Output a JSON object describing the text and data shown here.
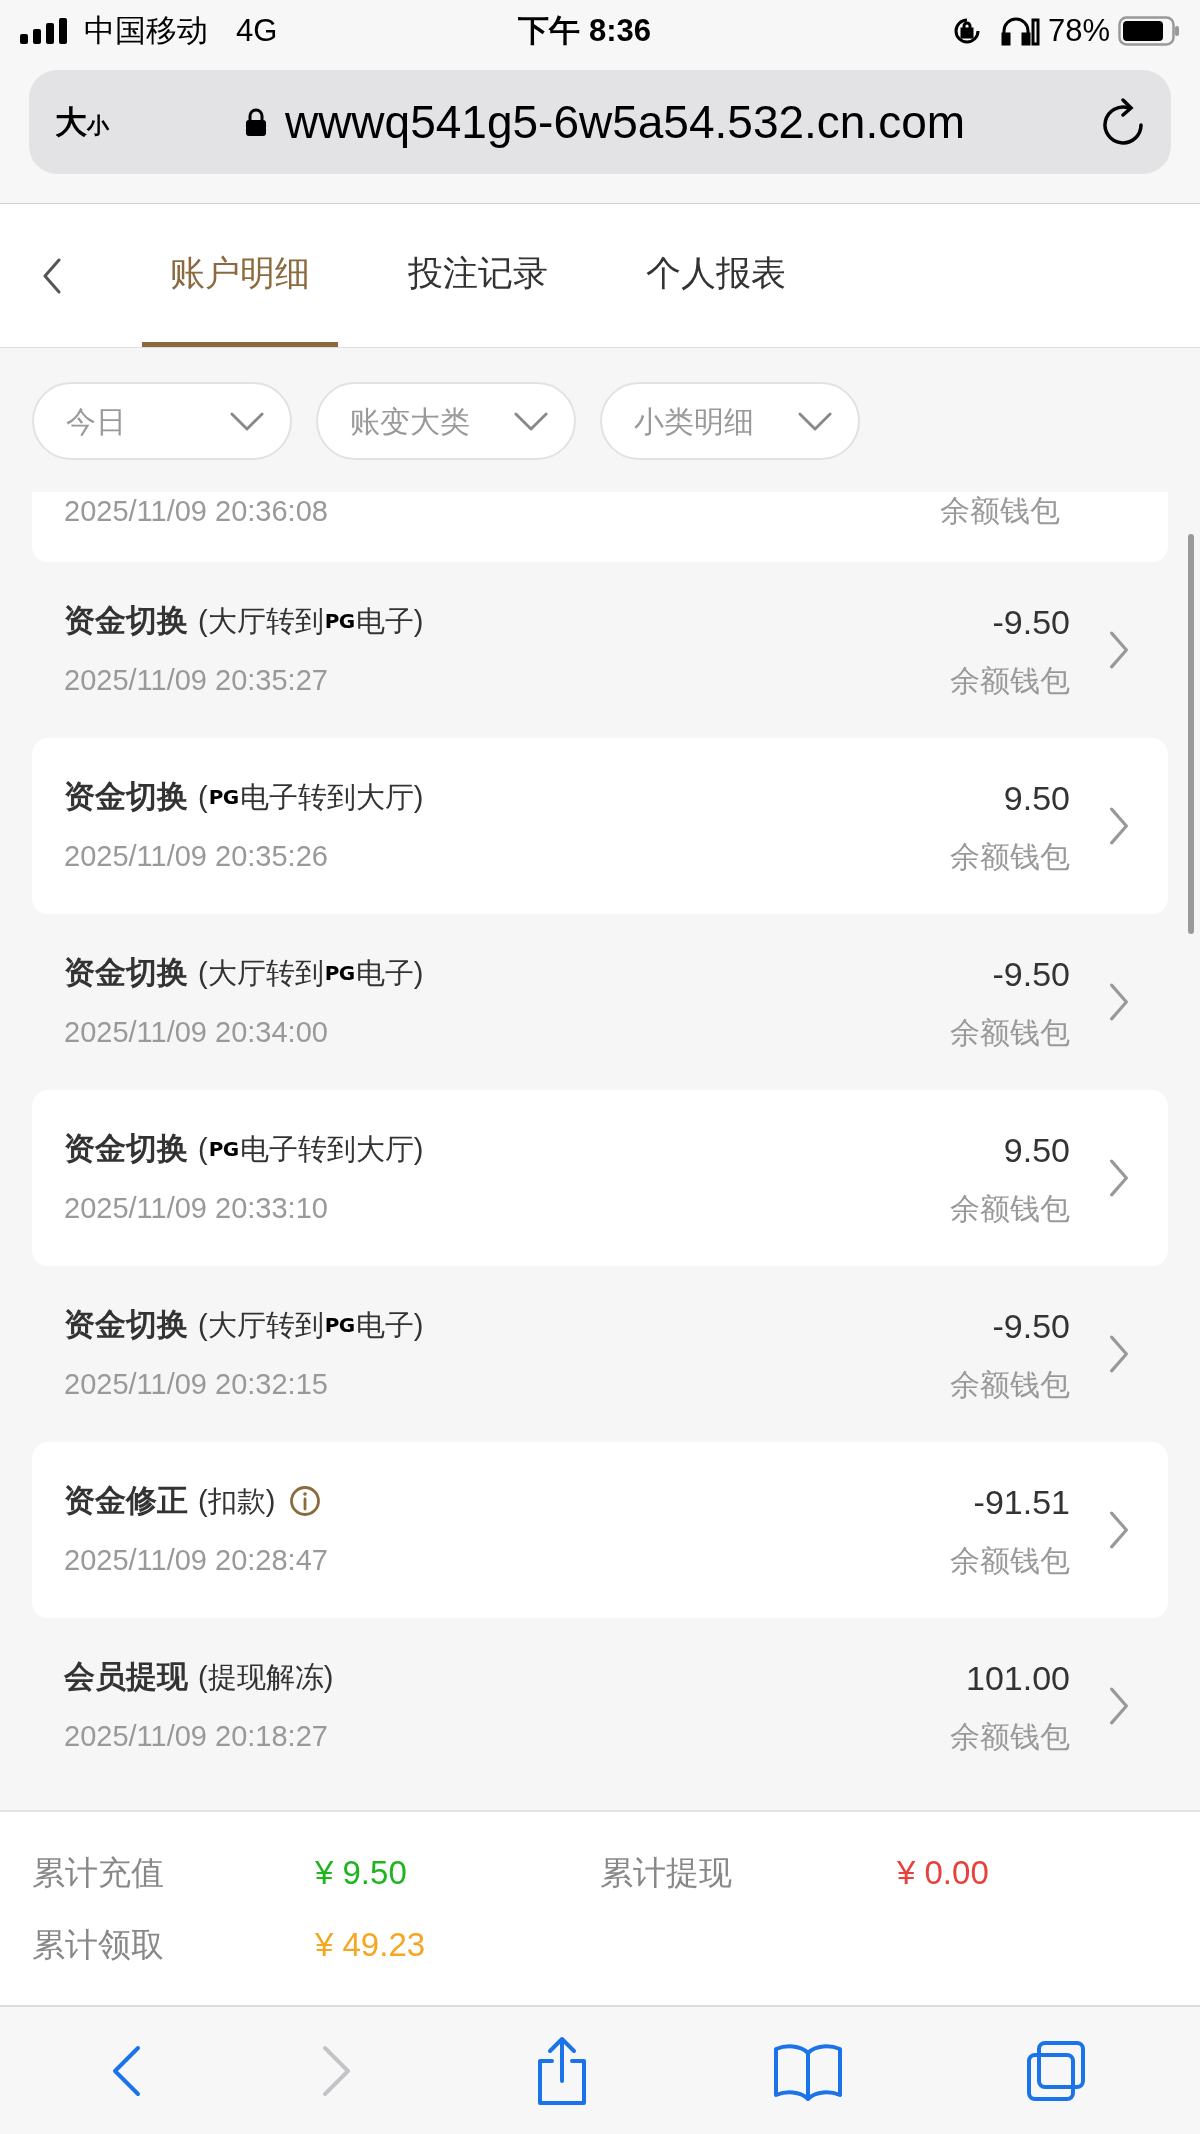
{
  "status_bar": {
    "carrier": "中国移动",
    "network": "4G",
    "time": "下午 8:36",
    "battery": "78%"
  },
  "address_bar": {
    "text_size": [
      "大",
      "小"
    ],
    "url": "wwwq541g5-6w5a54.532.cn.com"
  },
  "tabs": [
    {
      "label": "账户明细",
      "selected": true
    },
    {
      "label": "投注记录",
      "selected": false
    },
    {
      "label": "个人报表",
      "selected": false
    }
  ],
  "filters": [
    {
      "label": "今日"
    },
    {
      "label": "账变大类"
    },
    {
      "label": "小类明细"
    }
  ],
  "partial_row": {
    "time": "2025/11/09 20:36:08",
    "wallet": "余额钱包"
  },
  "rows": [
    {
      "title": "资金切换",
      "note": [
        {
          "kind": "text",
          "text": "(大厅转到"
        },
        {
          "kind": "logo",
          "text": "PG"
        },
        {
          "kind": "text",
          "text": "电子)"
        }
      ],
      "info": false,
      "time": "2025/11/09 20:35:27",
      "amount": "-9.50",
      "wallet": "余额钱包"
    },
    {
      "title": "资金切换",
      "note": [
        {
          "kind": "text",
          "text": "("
        },
        {
          "kind": "logo",
          "text": "PG"
        },
        {
          "kind": "text",
          "text": "电子转到大厅)"
        }
      ],
      "info": false,
      "time": "2025/11/09 20:35:26",
      "amount": "9.50",
      "wallet": "余额钱包"
    },
    {
      "title": "资金切换",
      "note": [
        {
          "kind": "text",
          "text": "(大厅转到"
        },
        {
          "kind": "logo",
          "text": "PG"
        },
        {
          "kind": "text",
          "text": "电子)"
        }
      ],
      "info": false,
      "time": "2025/11/09 20:34:00",
      "amount": "-9.50",
      "wallet": "余额钱包"
    },
    {
      "title": "资金切换",
      "note": [
        {
          "kind": "text",
          "text": "("
        },
        {
          "kind": "logo",
          "text": "PG"
        },
        {
          "kind": "text",
          "text": "电子转到大厅)"
        }
      ],
      "info": false,
      "time": "2025/11/09 20:33:10",
      "amount": "9.50",
      "wallet": "余额钱包"
    },
    {
      "title": "资金切换",
      "note": [
        {
          "kind": "text",
          "text": "(大厅转到"
        },
        {
          "kind": "logo",
          "text": "PG"
        },
        {
          "kind": "text",
          "text": "电子)"
        }
      ],
      "info": false,
      "time": "2025/11/09 20:32:15",
      "amount": "-9.50",
      "wallet": "余额钱包"
    },
    {
      "title": "资金修正",
      "note": [
        {
          "kind": "text",
          "text": "(扣款)"
        }
      ],
      "info": true,
      "time": "2025/11/09 20:28:47",
      "amount": "-91.51",
      "wallet": "余额钱包"
    },
    {
      "title": "会员提现",
      "note": [
        {
          "kind": "text",
          "text": "(提现解冻)"
        }
      ],
      "info": false,
      "time": "2025/11/09 20:18:27",
      "amount": "101.00",
      "wallet": "余额钱包"
    }
  ],
  "summary": [
    {
      "label": "累计充值",
      "value": "¥ 9.50",
      "color": "#1eb51e"
    },
    {
      "label": "累计提现",
      "value": "¥ 0.00",
      "color": "#e8403a"
    },
    {
      "label": "累计领取",
      "value": "¥ 49.23",
      "color": "#f5a623"
    }
  ],
  "toolbar": [
    {
      "kind": "back",
      "disabled": false
    },
    {
      "kind": "forward",
      "disabled": true
    },
    {
      "kind": "share",
      "disabled": false
    },
    {
      "kind": "bookmarks",
      "disabled": false
    },
    {
      "kind": "tabs",
      "disabled": false
    }
  ]
}
